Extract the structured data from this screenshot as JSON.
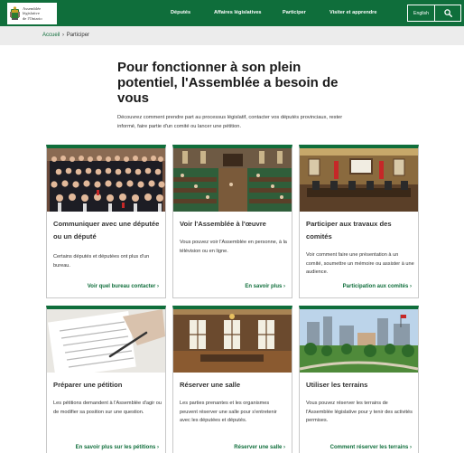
{
  "header": {
    "logo_text": [
      "Assemblée",
      "législative",
      "de l'Ontario"
    ],
    "nav": [
      "Députés",
      "Affaires législatives",
      "Participer",
      "Visiter et apprendre"
    ],
    "lang_label": "English",
    "search_icon": "search-icon",
    "brand_color": "#0f6e3b"
  },
  "breadcrumb": {
    "home": "Accueil",
    "separator": "›",
    "current": "Participer"
  },
  "main": {
    "title": "Pour fonctionner à son plein potentiel, l'Assemblée a besoin de vous",
    "intro": "Découvrez comment prendre part au processus législatif, contacter vos députés provinciaux, rester informé, faire partie d'un comité ou lancer une pétition."
  },
  "cards": [
    {
      "title": "Communiquer avec une députée ou un député",
      "desc": "Certains députés et députées ont plus d'un bureau.",
      "link": "Voir quel bureau contacter ›"
    },
    {
      "title": "Voir l'Assemblée à l'œuvre",
      "desc": "Vous pouvez voir l'Assemblée en personne, à la télévision ou en ligne.",
      "link": "En savoir plus ›"
    },
    {
      "title": "Participer aux travaux des comités",
      "desc": "Voir comment faire une présentation à un comité, soumettre un mémoire ou assister à une audience.",
      "link": "Participation aux comités ›"
    },
    {
      "title": "Préparer une pétition",
      "desc": "Les pétitions demandent à l'Assemblée d'agir ou de modifier sa position sur une question.",
      "link": "En savoir plus sur les pétitions ›"
    },
    {
      "title": "Réserver une salle",
      "desc": "Les parties prenantes et les organismes peuvent réserver une salle pour s'entretenir avec les députées et députés.",
      "link": "Réserver une salle ›"
    },
    {
      "title": "Utiliser les terrains",
      "desc": "Vous pouvez réserver les terrains de l'Assemblée législative pour y tenir des activités permises.",
      "link": "Comment réserver les terrains ›"
    }
  ]
}
